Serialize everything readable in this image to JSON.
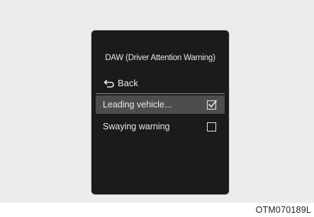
{
  "screen": {
    "title": "DAW (Driver Attention Warning)",
    "back_label": "Back",
    "items": [
      {
        "label": "Leading vehicle...",
        "checked": true,
        "selected": true
      },
      {
        "label": "Swaying warning",
        "checked": false,
        "selected": false
      }
    ]
  },
  "caption": "OTM070189L",
  "icons": {
    "back": "back-arrow-icon",
    "checked": "checkbox-checked-icon",
    "unchecked": "checkbox-empty-icon"
  },
  "colors": {
    "screen_bg": "#1b1b1b",
    "highlight": "#4d4d4d",
    "text": "#e9e9e9"
  }
}
